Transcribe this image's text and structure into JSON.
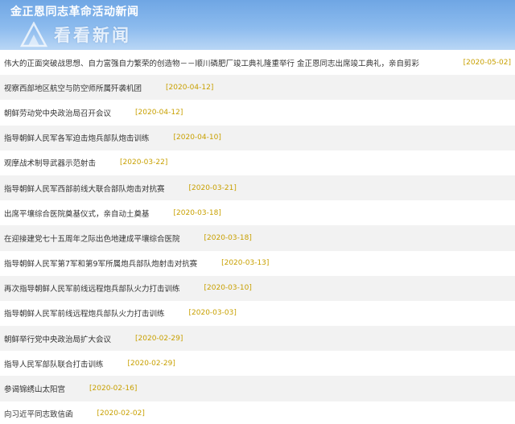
{
  "header": {
    "title": "金正恩同志革命活动新闻",
    "watermark": "看看新闻"
  },
  "news": [
    {
      "title": "伟大的正面突破战思想、自力富强自力繁荣的创造物－－顺川磷肥厂竣工典礼隆重举行 金正恩同志出席竣工典礼，亲自剪彩",
      "date": "[2020-05-02]"
    },
    {
      "title": "视察西部地区航空与防空师所属歼袭机团",
      "date": "[2020-04-12]"
    },
    {
      "title": "朝鲜劳动党中央政治局召开会议",
      "date": "[2020-04-12]"
    },
    {
      "title": "指导朝鲜人民军各军迫击炮兵部队炮击训练",
      "date": "[2020-04-10]"
    },
    {
      "title": "观摩战术制导武器示范射击",
      "date": "[2020-03-22]"
    },
    {
      "title": "指导朝鲜人民军西部前线大联合部队炮击对抗赛",
      "date": "[2020-03-21]"
    },
    {
      "title": "出席平壤综合医院奠基仪式，亲自动土奠基",
      "date": "[2020-03-18]"
    },
    {
      "title": "在迎接建党七十五周年之际出色地建成平壤综合医院",
      "date": "[2020-03-18]"
    },
    {
      "title": "指导朝鲜人民军第7军和第9军所属炮兵部队炮射击对抗赛",
      "date": "[2020-03-13]"
    },
    {
      "title": "再次指导朝鲜人民军前线远程炮兵部队火力打击训练",
      "date": "[2020-03-10]"
    },
    {
      "title": "指导朝鲜人民军前线远程炮兵部队火力打击训练",
      "date": "[2020-03-03]"
    },
    {
      "title": "朝鲜举行党中央政治局扩大会议",
      "date": "[2020-02-29]"
    },
    {
      "title": "指导人民军部队联合打击训练",
      "date": "[2020-02-29]"
    },
    {
      "title": "参谒锦绣山太阳宫",
      "date": "[2020-02-16]"
    },
    {
      "title": "向习近平同志致信函",
      "date": "[2020-02-02]"
    }
  ]
}
